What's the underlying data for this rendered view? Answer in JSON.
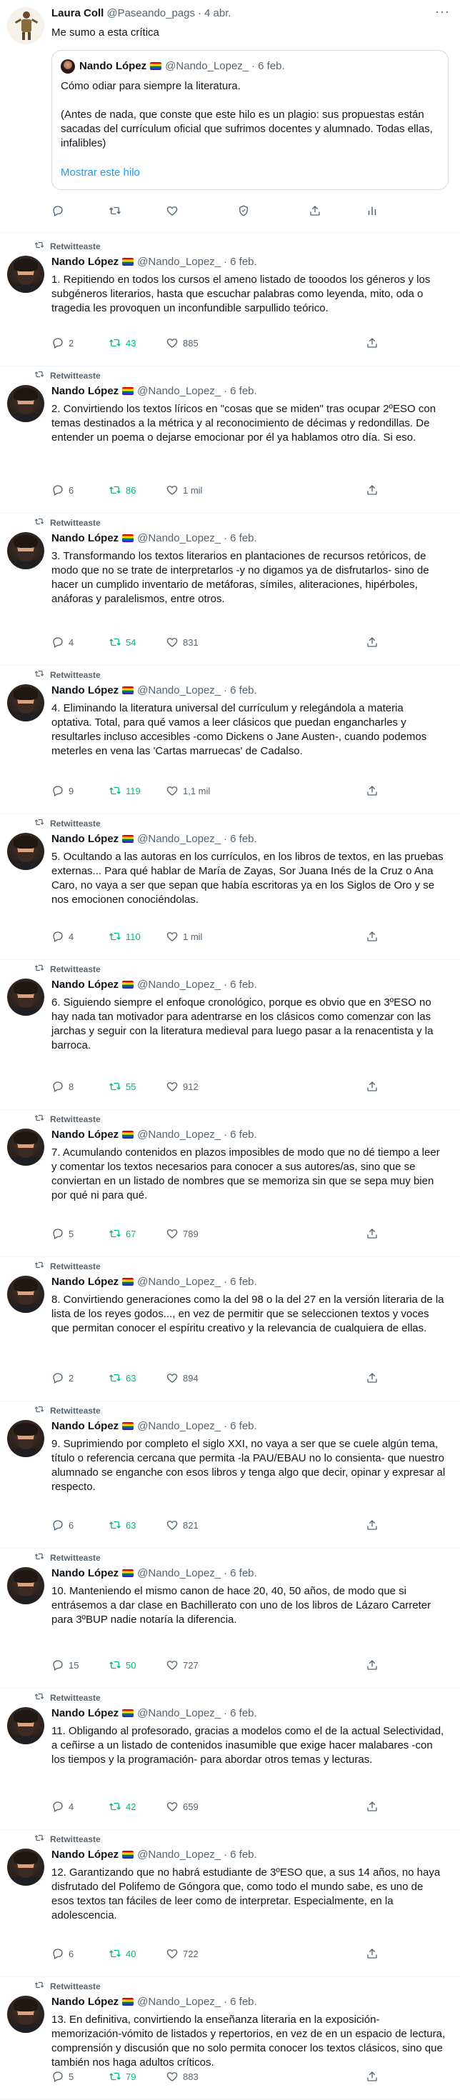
{
  "colors": {
    "accent": "#1d9bf0",
    "retweet_green": "#00ba7c",
    "muted": "#536471"
  },
  "main_tweet": {
    "name": "Laura Coll",
    "handle": "@Paseando_pags",
    "date": "4 abr.",
    "text": "Me sumo a esta crítica",
    "quoted": {
      "name": "Nando López",
      "handle": "@Nando_Lopez_",
      "date": "6 feb.",
      "line1": "Cómo odiar para siempre la literatura.",
      "line2": "(Antes de nada, que conste que este hilo es un plagio: sus propuestas están sacadas del currículum oficial que sufrimos docentes y alumnado. Todas ellas, infalibles)",
      "show_thread": "Mostrar este hilo"
    }
  },
  "retweet_label": "Retwitteaste",
  "author": {
    "name": "Nando López",
    "handle": "@Nando_Lopez_",
    "date": "6 feb."
  },
  "thread": [
    {
      "text": "1. Repitiendo en todos los cursos el ameno listado de tooodos los géneros y los subgéneros literarios, hasta que escuchar palabras como leyenda, mito, oda o tragedia les provoquen un inconfundible sarpullido teórico.",
      "replies": "2",
      "retweets": "43",
      "likes": "885"
    },
    {
      "text": "2. Convirtiendo los textos líricos en \"cosas que se miden\" tras ocupar 2ºESO con temas destinados a la métrica y al reconocimiento de décimas y redondillas. De entender un poema o dejarse emocionar por él ya hablamos otro día. Si eso.",
      "replies": "6",
      "retweets": "86",
      "likes": "1 mil"
    },
    {
      "text": "3. Transformando los textos literarios en plantaciones de recursos retóricos, de modo que no se trate de interpretarlos -y no digamos ya de disfrutarlos- sino de hacer un cumplido inventario de metáforas, símiles, aliteraciones, hipérboles, anáforas y paralelismos, entre otros.",
      "replies": "4",
      "retweets": "54",
      "likes": "831"
    },
    {
      "text": "4. Eliminando la literatura universal del currículum y relegándola a materia optativa. Total, para qué vamos a leer clásicos que puedan engancharles y resultarles incluso accesibles -como Dickens o Jane Austen-, cuando podemos meterles en vena las 'Cartas marruecas' de Cadalso.",
      "replies": "9",
      "retweets": "119",
      "likes": "1,1 mil"
    },
    {
      "text": "5. Ocultando a las autoras en los currículos, en los libros de textos, en las pruebas externas... Para qué hablar de María de Zayas, Sor Juana Inés de la Cruz o Ana Caro, no vaya a ser que sepan que había escritoras ya en los Siglos de Oro y se nos emocionen conociéndolas.",
      "replies": "4",
      "retweets": "110",
      "likes": "1 mil"
    },
    {
      "text": "6. Siguiendo siempre el enfoque cronológico, porque es obvio que en 3ºESO no hay nada tan motivador para adentrarse en los clásicos como comenzar con las jarchas y seguir con la literatura medieval para luego pasar a la renacentista y la barroca.",
      "replies": "8",
      "retweets": "55",
      "likes": "912"
    },
    {
      "text": "7. Acumulando contenidos en plazos imposibles de modo que no dé tiempo a leer y comentar los textos necesarios para conocer a sus autores/as, sino que se conviertan en un listado de nombres que se memoriza sin que se sepa muy bien por qué ni para qué.",
      "replies": "5",
      "retweets": "67",
      "likes": "789"
    },
    {
      "text": "8. Convirtiendo generaciones como la del 98 o la del 27 en la versión literaria de la lista de los reyes godos..., en vez de permitir que se seleccionen textos y voces que permitan conocer el espíritu creativo y la relevancia de cualquiera de ellas.",
      "replies": "2",
      "retweets": "63",
      "likes": "894"
    },
    {
      "text": "9. Suprimiendo por completo el siglo XXI, no vaya a ser que se cuele algún tema, título o referencia cercana que permita -la PAU/EBAU no lo consienta- que nuestro alumnado se enganche con esos libros y tenga algo que decir, opinar y expresar al respecto.",
      "replies": "6",
      "retweets": "63",
      "likes": "821"
    },
    {
      "text": "10. Manteniendo el mismo canon de hace 20, 40, 50 años, de modo que si entrásemos a dar clase en Bachillerato con uno de los libros de Lázaro Carreter para 3ºBUP nadie notaría la diferencia.",
      "replies": "15",
      "retweets": "50",
      "likes": "727"
    },
    {
      "text": "11. Obligando al profesorado, gracias a modelos como el de la actual Selectividad, a ceñirse a un listado de contenidos inasumible que exige hacer malabares -con los tiempos y la programación- para abordar otros temas y lecturas.",
      "replies": "4",
      "retweets": "42",
      "likes": "659"
    },
    {
      "text": "12. Garantizando que no habrá estudiante de 3ºESO que, a sus 14 años, no haya disfrutado del Polifemo de Góngora que, como todo el mundo sabe, es uno de esos textos tan fáciles de leer como de interpretar. Especialmente, en la adolescencia.",
      "replies": "6",
      "retweets": "40",
      "likes": "722"
    },
    {
      "text": "13. En definitiva, convirtiendo la enseñanza literaria en la exposición-memorización-vómito de listados y repertorios, en vez de en un espacio de lectura, comprensión y discusión que no solo permita conocer los textos clásicos, sino que también nos haga adultos críticos.",
      "replies": "5",
      "retweets": "79",
      "likes": "883"
    }
  ]
}
